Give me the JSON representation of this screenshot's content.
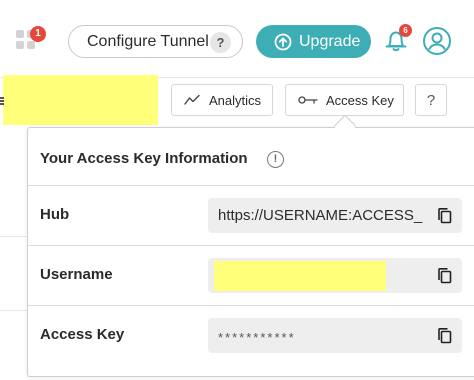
{
  "header": {
    "apps_badge": "1",
    "configure_label": "Configure Tunnel",
    "configure_help": "?",
    "upgrade_label": "Upgrade",
    "notifications_badge": "6"
  },
  "toolbar": {
    "analytics_label": "Analytics",
    "access_key_label": "Access Key",
    "help_label": "?"
  },
  "popover": {
    "title": "Your Access Key Information",
    "info_glyph": "!",
    "rows": [
      {
        "label": "Hub",
        "value": "https://USERNAME:ACCESS_"
      },
      {
        "label": "Username",
        "value": ""
      },
      {
        "label": "Access Key",
        "value": "***********"
      }
    ]
  },
  "colors": {
    "accent": "#3eaeb6",
    "badge": "#e5483a",
    "redaction": "#ffff7a"
  }
}
